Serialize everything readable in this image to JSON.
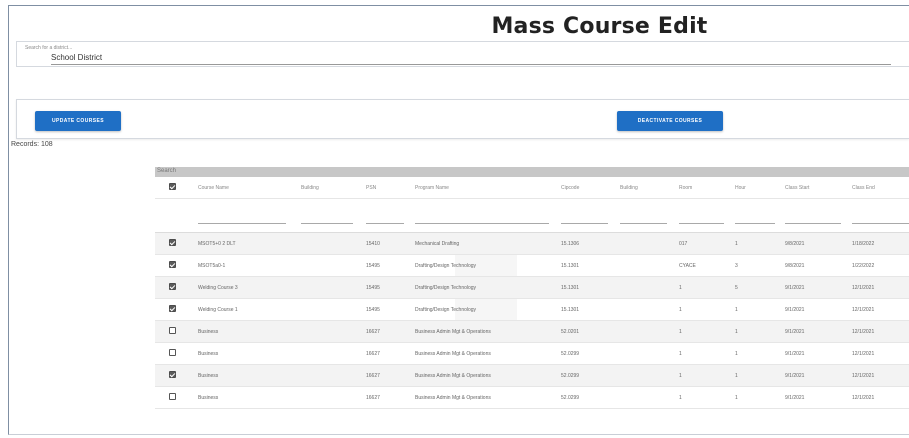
{
  "page": {
    "title": "Mass Course Edit"
  },
  "search": {
    "placeholder": "Search for a district...",
    "value": "School District"
  },
  "actions": {
    "update_label": "UPDATE COURSES",
    "deactivate_label": "DEACTIVATE COURSES"
  },
  "records": {
    "label": "Records: 108"
  },
  "grid": {
    "search_label": "Search",
    "columns": [
      "Course Name",
      "Building",
      "PSN",
      "Program Name",
      "Cipcode",
      "Building",
      "Room",
      "Hour",
      "Class Start",
      "Class End"
    ],
    "rows": [
      {
        "checked": true,
        "course": "MSOT5+0 2 DLT",
        "building": "",
        "psn": "15410",
        "program": "Mechanical Drafting",
        "cip": "15.1306",
        "building2": "",
        "room": "017",
        "hour": "1",
        "start": "9/8/2021",
        "end": "1/18/2022"
      },
      {
        "checked": true,
        "course": "MSOT5a0-1",
        "building": "",
        "psn": "15495",
        "program": "Drafting/Design Technology",
        "cip": "15.1301",
        "building2": "",
        "room": "CYACE",
        "hour": "3",
        "start": "9/8/2021",
        "end": "1/22/2022"
      },
      {
        "checked": true,
        "course": "Welding Course 3",
        "building": "",
        "psn": "15495",
        "program": "Drafting/Design Technology",
        "cip": "15.1301",
        "building2": "",
        "room": "1",
        "hour": "5",
        "start": "9/1/2021",
        "end": "12/1/2021"
      },
      {
        "checked": true,
        "course": "Welding Course 1",
        "building": "",
        "psn": "15495",
        "program": "Drafting/Design Technology",
        "cip": "15.1301",
        "building2": "",
        "room": "1",
        "hour": "1",
        "start": "9/1/2021",
        "end": "12/1/2021"
      },
      {
        "checked": false,
        "course": "Business",
        "building": "",
        "psn": "16627",
        "program": "Business Admin Mgt & Operations",
        "cip": "52.0201",
        "building2": "",
        "room": "1",
        "hour": "1",
        "start": "9/1/2021",
        "end": "12/1/2021"
      },
      {
        "checked": false,
        "course": "Business",
        "building": "",
        "psn": "16627",
        "program": "Business Admin Mgt & Operations",
        "cip": "52.0299",
        "building2": "",
        "room": "1",
        "hour": "1",
        "start": "9/1/2021",
        "end": "12/1/2021"
      },
      {
        "checked": true,
        "course": "Business",
        "building": "",
        "psn": "16627",
        "program": "Business Admin Mgt & Operations",
        "cip": "52.0299",
        "building2": "",
        "room": "1",
        "hour": "1",
        "start": "9/1/2021",
        "end": "12/1/2021"
      },
      {
        "checked": false,
        "course": "Business",
        "building": "",
        "psn": "16627",
        "program": "Business Admin Mgt & Operations",
        "cip": "52.0299",
        "building2": "",
        "room": "1",
        "hour": "1",
        "start": "9/1/2021",
        "end": "12/1/2021"
      }
    ]
  },
  "colors": {
    "primary_button": "#1f6fc5",
    "grid_search_bar": "#c7c7c7",
    "checkbox_checked": "#5b5b5b"
  }
}
